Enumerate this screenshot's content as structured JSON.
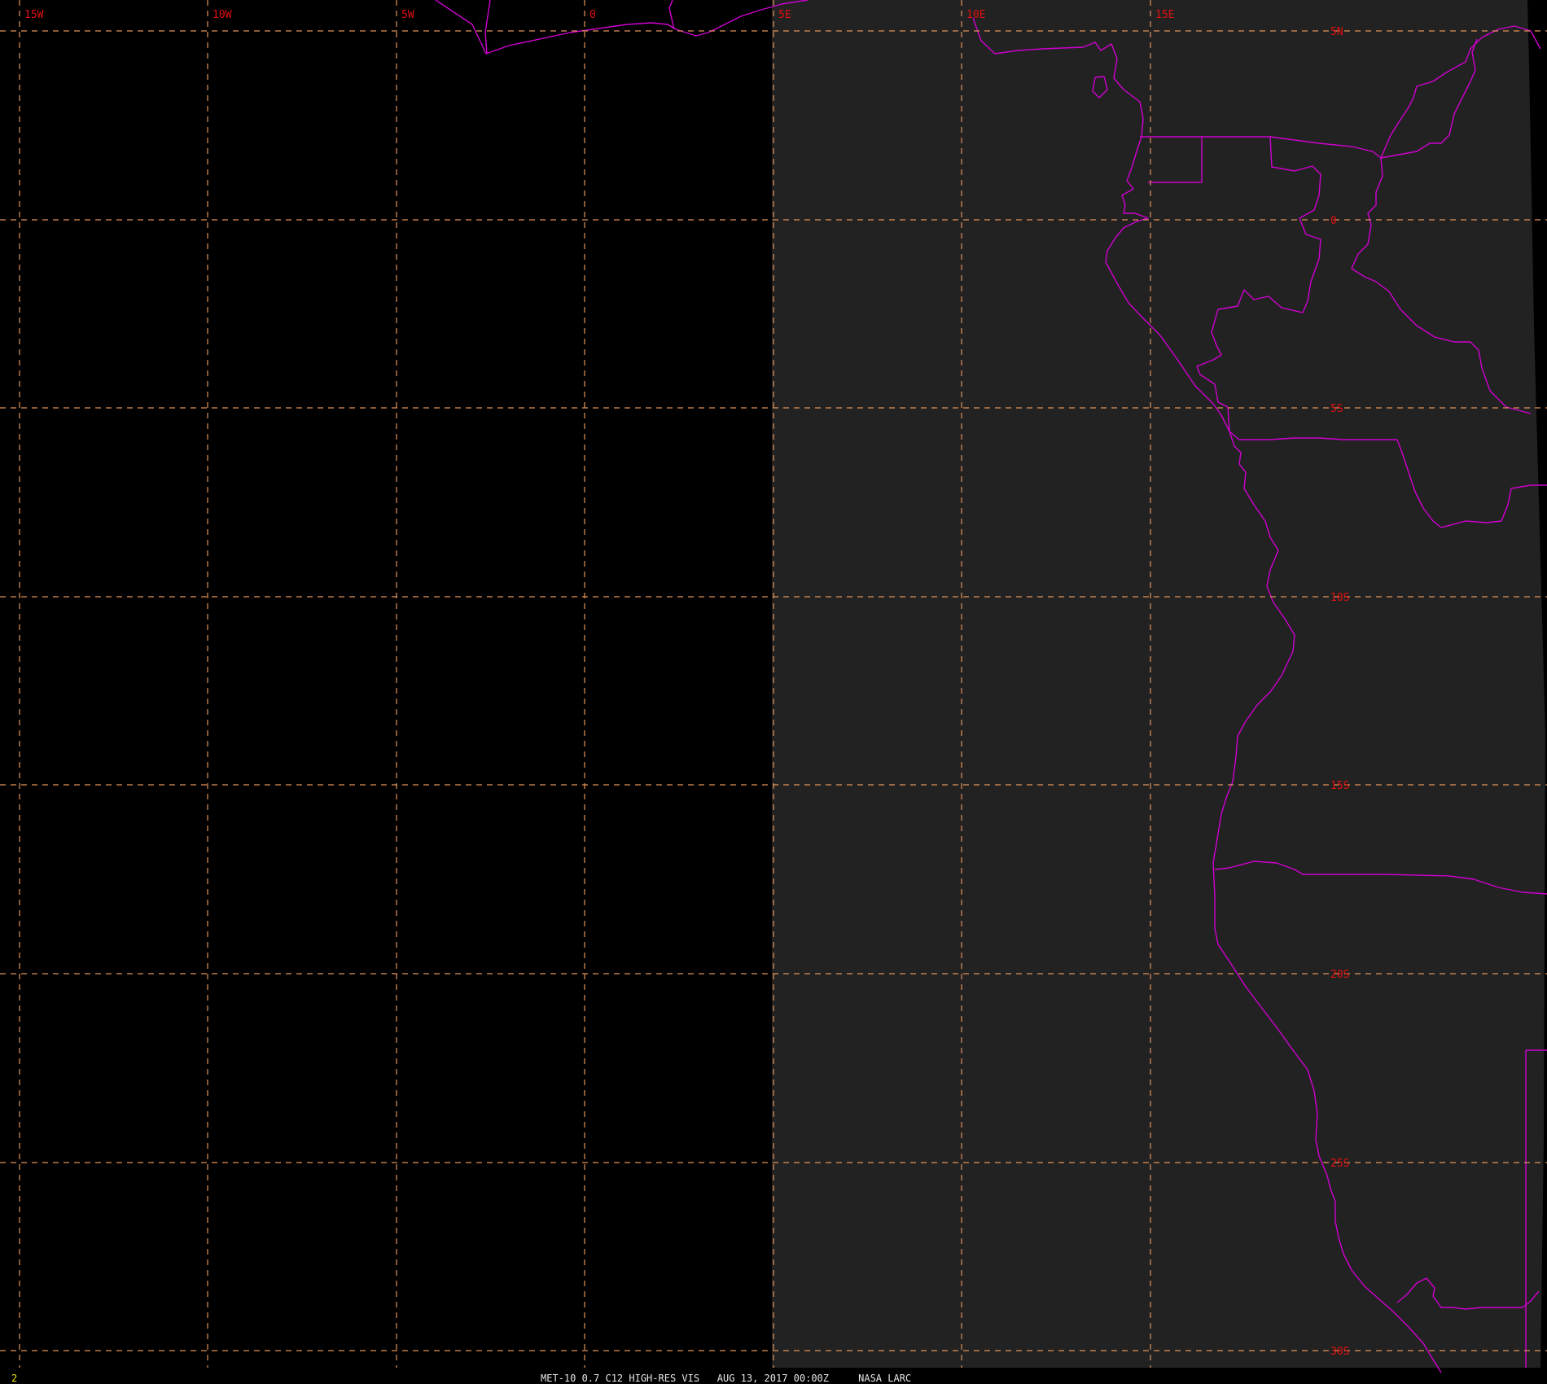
{
  "colors": {
    "background": "#000000",
    "sunlit_disk": "#222222",
    "grid": "#e0945a",
    "grid_label": "#e01010",
    "boundaries": "#d000d0",
    "footer_text": "#e6e6e6",
    "frame_number": "#e8e800"
  },
  "map": {
    "longitude_labels": [
      "15W",
      "10W",
      "5W",
      "0",
      "5E",
      "10E",
      "15E"
    ],
    "latitude_labels": [
      "5N",
      "0",
      "5S",
      "10S",
      "15S",
      "20S",
      "25S",
      "30S"
    ]
  },
  "footer": {
    "frame_number": "2",
    "caption": "MET-10 0.7 C12 HIGH-RES VIS   AUG 13, 2017 00:00Z     NASA LARC"
  }
}
